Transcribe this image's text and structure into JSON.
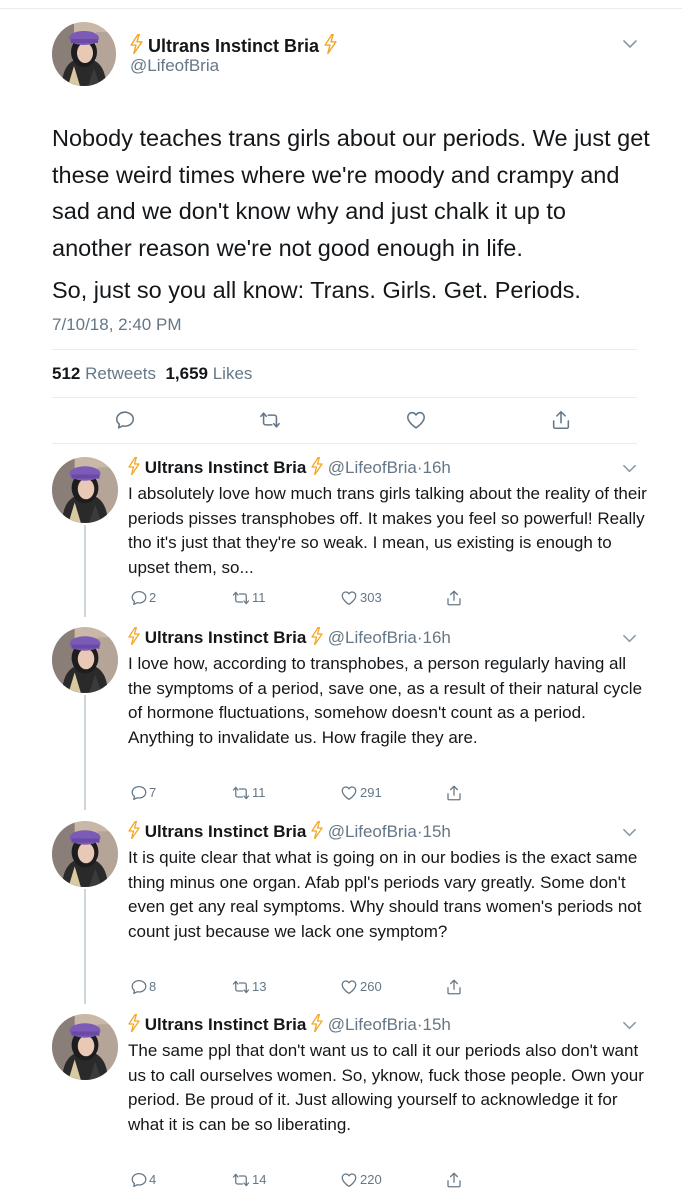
{
  "main_tweet": {
    "display_name": "Ultrans Instinct Bria",
    "handle": "@LifeofBria",
    "text_para1": "Nobody teaches trans girls about our periods. We just get these weird times where we're moody and crampy and sad and we don't know why and just chalk it up to another reason we're not good enough in life.",
    "text_para2": "So, just so you all know: Trans. Girls. Get. Periods.",
    "timestamp": "7/10/18, 2:40 PM",
    "retweets_count": "512",
    "retweets_label": "Retweets",
    "likes_count": "1,659",
    "likes_label": "Likes"
  },
  "icons": {
    "name_decoration": "lightning-bolt-icon",
    "reply": "reply-bubble-icon",
    "retweet": "retweet-icon",
    "like": "heart-icon",
    "share": "share-icon",
    "menu": "chevron-down-icon"
  },
  "colors": {
    "bolt": "#f5a623",
    "secondary_text": "#657786",
    "divider": "#e6ecf0",
    "thread_line": "#ccd6dd"
  },
  "replies": [
    {
      "display_name": "Ultrans Instinct Bria",
      "handle": "@LifeofBria",
      "dot": "·",
      "time": "16h",
      "text": "I absolutely love how much trans girls talking about the reality of their periods pisses transphobes off. It makes you feel so powerful! Really tho it's just that they're so weak. I mean, us existing is enough to upset them, so...",
      "reply_count": "2",
      "retweet_count": "11",
      "like_count": "303"
    },
    {
      "display_name": "Ultrans Instinct Bria",
      "handle": "@LifeofBria",
      "dot": "·",
      "time": "16h",
      "text": "I love how, according to transphobes, a person regularly having all the symptoms of a period, save one, as a result of their natural cycle of hormone fluctuations, somehow doesn't count as a period. Anything to invalidate us. How fragile they are.",
      "reply_count": "7",
      "retweet_count": "11",
      "like_count": "291"
    },
    {
      "display_name": "Ultrans Instinct Bria",
      "handle": "@LifeofBria",
      "dot": "·",
      "time": "15h",
      "text": "It is quite clear that what is going on in our bodies is the exact same thing minus one organ. Afab ppl's periods vary greatly. Some don't even get any real symptoms. Why should trans women's periods not count just because we lack one symptom?",
      "reply_count": "8",
      "retweet_count": "13",
      "like_count": "260"
    },
    {
      "display_name": "Ultrans Instinct Bria",
      "handle": "@LifeofBria",
      "dot": "·",
      "time": "15h",
      "text": "The same ppl that don't want us to call it our periods also don't want us to call ourselves women. So, yknow, fuck those people. Own your period. Be proud of it. Just allowing yourself to acknowledge it for what it is can be so liberating.",
      "reply_count": "4",
      "retweet_count": "14",
      "like_count": "220"
    }
  ]
}
